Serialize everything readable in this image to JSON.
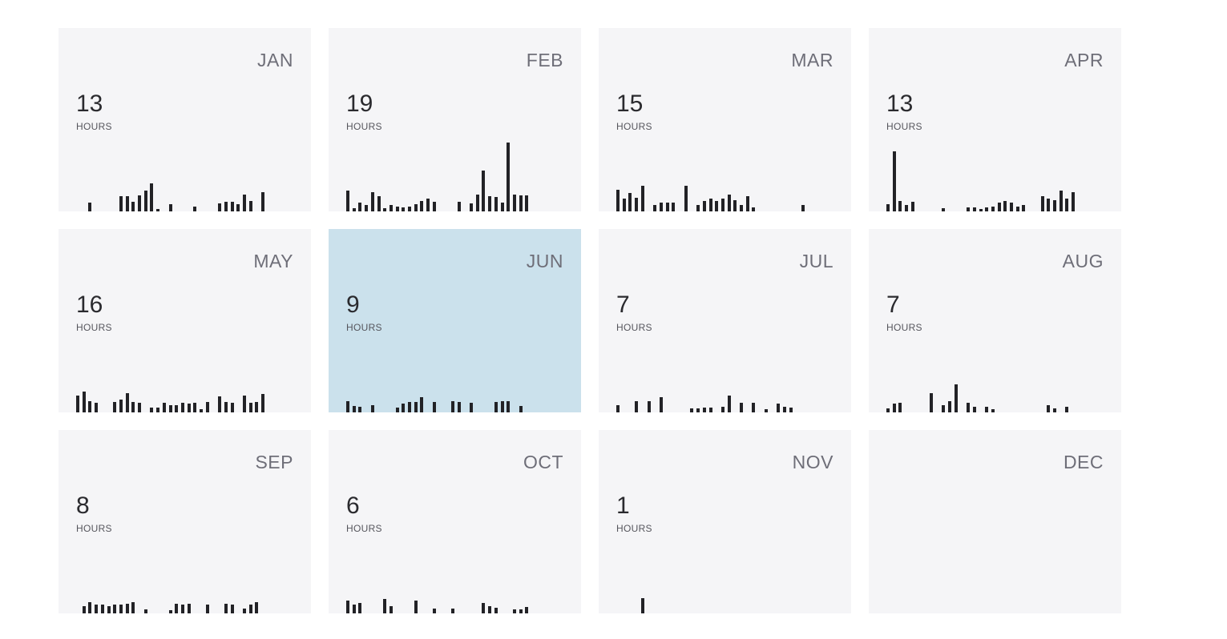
{
  "hours_label": "HOURS",
  "colors": {
    "card_background": "#f5f5f7",
    "selected_background": "#cbe1ec",
    "bar": "#222226"
  },
  "selected_month": "JUN",
  "months": [
    {
      "name": "JAN",
      "hours": "13",
      "daily": [
        0,
        0,
        0.2,
        0,
        0,
        0,
        0,
        0.35,
        0.35,
        0.22,
        0.38,
        0.48,
        0.65,
        0.05,
        0,
        0.16,
        0,
        0,
        0,
        0.11,
        0,
        0,
        0,
        0.18,
        0.22,
        0.22,
        0.17,
        0.4,
        0.25,
        0,
        0.45
      ]
    },
    {
      "name": "FEB",
      "hours": "19",
      "daily": [
        0.48,
        0.07,
        0.2,
        0.15,
        0.45,
        0.35,
        0.07,
        0.15,
        0.12,
        0.09,
        0.12,
        0.17,
        0.25,
        0.3,
        0.22,
        0,
        0,
        0,
        0.22,
        0,
        0.18,
        0.4,
        0.95,
        0.35,
        0.33,
        0.2,
        1.6,
        0.4,
        0.38,
        0.38,
        0
      ]
    },
    {
      "name": "MAR",
      "hours": "15",
      "daily": [
        0.5,
        0.3,
        0.42,
        0.32,
        0.6,
        0,
        0.15,
        0.2,
        0.2,
        0.2,
        0,
        0.6,
        0,
        0.15,
        0.25,
        0.3,
        0.25,
        0.3,
        0.4,
        0.27,
        0.14,
        0.35,
        0.1,
        0,
        0,
        0,
        0,
        0,
        0,
        0,
        0.15
      ]
    },
    {
      "name": "APR",
      "hours": "13",
      "daily": [
        0.16,
        1.4,
        0.25,
        0.15,
        0.22,
        0,
        0,
        0,
        0,
        0.08,
        0,
        0,
        0,
        0.1,
        0.1,
        0.05,
        0.1,
        0.12,
        0.2,
        0.24,
        0.2,
        0.12,
        0.15,
        0,
        0,
        0.35,
        0.3,
        0.27,
        0.48,
        0.3,
        0.45
      ]
    },
    {
      "name": "MAY",
      "hours": "16",
      "daily": [
        0.4,
        0.48,
        0.27,
        0.22,
        0,
        0,
        0.25,
        0.3,
        0.45,
        0.25,
        0.22,
        0,
        0.11,
        0.12,
        0.22,
        0.17,
        0.17,
        0.22,
        0.2,
        0.22,
        0.07,
        0.25,
        0,
        0.37,
        0.25,
        0.22,
        0,
        0.4,
        0.22,
        0.25,
        0.42
      ]
    },
    {
      "name": "JUN",
      "hours": "9",
      "daily": [
        0.27,
        0.15,
        0.13,
        0,
        0.16,
        0,
        0,
        0,
        0.11,
        0.2,
        0.25,
        0.25,
        0.35,
        0,
        0.25,
        0,
        0,
        0.27,
        0.25,
        0,
        0.22,
        0,
        0,
        0,
        0.25,
        0.27,
        0.27,
        0,
        0.14,
        0,
        0
      ]
    },
    {
      "name": "JUL",
      "hours": "7",
      "daily": [
        0.17,
        0,
        0,
        0.27,
        0,
        0.27,
        0,
        0.35,
        0,
        0,
        0,
        0,
        0.1,
        0.1,
        0.12,
        0.12,
        0,
        0.13,
        0.4,
        0,
        0.23,
        0,
        0.22,
        0,
        0.07,
        0,
        0.2,
        0.13,
        0.12,
        0,
        0
      ]
    },
    {
      "name": "AUG",
      "hours": "7",
      "daily": [
        0.1,
        0.2,
        0.22,
        0,
        0,
        0,
        0,
        0.45,
        0,
        0.17,
        0.27,
        0.65,
        0,
        0.22,
        0.13,
        0,
        0.13,
        0.08,
        0,
        0,
        0,
        0,
        0,
        0,
        0,
        0,
        0.17,
        0.1,
        0,
        0.13,
        0
      ]
    },
    {
      "name": "SEP",
      "hours": "8",
      "daily": [
        0,
        0.17,
        0.27,
        0.2,
        0.2,
        0.17,
        0.2,
        0.2,
        0.22,
        0.27,
        0,
        0.1,
        0,
        0,
        0,
        0.07,
        0.22,
        0.2,
        0.22,
        0,
        0,
        0.2,
        0,
        0,
        0.22,
        0.2,
        0,
        0.12,
        0.2,
        0.27,
        0
      ]
    },
    {
      "name": "OCT",
      "hours": "6",
      "daily": [
        0.3,
        0.2,
        0.25,
        0,
        0,
        0,
        0.33,
        0.17,
        0,
        0,
        0,
        0.3,
        0,
        0,
        0.12,
        0,
        0,
        0.12,
        0,
        0,
        0,
        0,
        0.25,
        0.17,
        0.13,
        0,
        0,
        0.1,
        0.1,
        0.15,
        0
      ]
    },
    {
      "name": "NOV",
      "hours": "1",
      "daily": [
        0,
        0,
        0,
        0,
        0.35,
        0,
        0,
        0,
        0,
        0,
        0,
        0,
        0,
        0,
        0,
        0,
        0,
        0,
        0,
        0,
        0,
        0,
        0,
        0,
        0,
        0,
        0,
        0,
        0,
        0,
        0
      ]
    },
    {
      "name": "DEC",
      "hours": "",
      "daily": []
    }
  ]
}
